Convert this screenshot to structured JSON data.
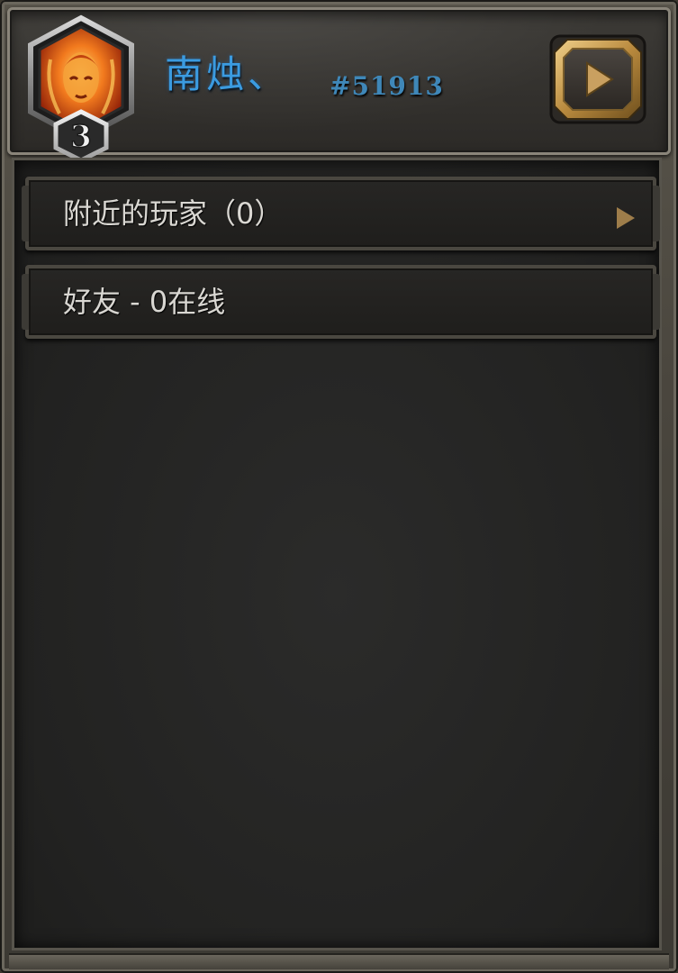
{
  "header": {
    "player_name": "南烛、",
    "player_tag": "#51913",
    "rank_level": "3",
    "avatar_icon": "fiery-portrait-icon",
    "play_icon": "play-triangle-icon"
  },
  "list": {
    "rows": [
      {
        "label": "附近的玩家（0）",
        "has_arrow": true
      },
      {
        "label": "好友 - 0在线",
        "has_arrow": false
      }
    ]
  },
  "colors": {
    "name": "#3b9be0",
    "tag": "#3f87b8",
    "accent_gold": "#c79e59",
    "row_text": "#d9d7d2"
  }
}
